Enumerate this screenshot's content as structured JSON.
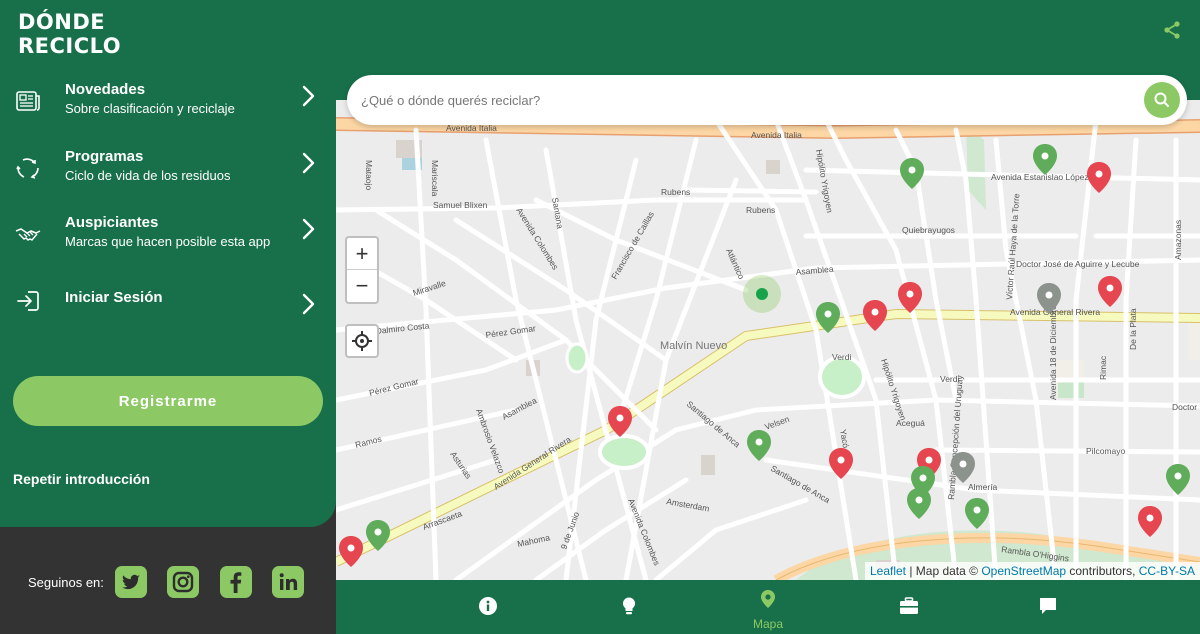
{
  "app": {
    "logo_line1": "DÓNDE",
    "logo_line2": "RECICLO"
  },
  "sidebar": {
    "items": [
      {
        "title": "Novedades",
        "subtitle": "Sobre clasificación y reciclaje",
        "icon": "newspaper-icon"
      },
      {
        "title": "Programas",
        "subtitle": "Ciclo de vida de los residuos",
        "icon": "recycle-cycle-icon"
      },
      {
        "title": "Auspiciantes",
        "subtitle": "Marcas que hacen posible esta app",
        "icon": "handshake-icon"
      },
      {
        "title": "Iniciar Sesión",
        "subtitle": "",
        "icon": "login-icon"
      }
    ],
    "register_label": "Registrarme",
    "repeat_intro_label": "Repetir introducción",
    "follow_label": "Seguinos en:",
    "social": [
      "twitter-icon",
      "instagram-icon",
      "facebook-icon",
      "linkedin-icon"
    ]
  },
  "search": {
    "placeholder": "¿Qué o dónde querés reciclar?"
  },
  "map": {
    "zoom_in": "+",
    "zoom_out": "−",
    "attribution_leaflet": "Leaflet",
    "attribution_sep": " | Map data © ",
    "attribution_osm": "OpenStreetMap",
    "attribution_mid": " contributors, ",
    "attribution_license": "CC-BY-SA",
    "neighborhood": "Malvín Nuevo",
    "streets": {
      "italia": "Avenida Italia",
      "rivera": "Avenida General Rivera",
      "rivera2": "Avenida General Rivera",
      "estanislao": "Avenida Estanislao López",
      "ohiggins": "Rambla O'Higgins",
      "rubens": "Rubens",
      "rubens2": "Rubens",
      "quiebrayugos": "Quiebrayugos",
      "aguirre": "Doctor José de Aguirre y Lecube",
      "samuel": "Samuel Blixen",
      "perez": "Pérez Gomar",
      "perez2": "Pérez Gomar",
      "dalmiro": "Dalmiro Costa",
      "asamblea": "Asamblea",
      "asamblea2": "Asamblea",
      "verdi": "Verdi",
      "verdi2": "Verdi",
      "acegua": "Aceguá",
      "pilcomayo": "Pilcomayo",
      "almeria": "Almería",
      "amsterdam": "Amsterdam",
      "mahoma": "Mahoma",
      "ramos": "Ramos",
      "arrascaeta": "Arrascaeta",
      "santiago": "Santiago de Anca",
      "hipolito": "Hipólito Yrigoyen",
      "velsen": "Velsen",
      "yaco": "Yacó",
      "colombes": "Avenida Colombes",
      "canelones": "Avenida Colombes",
      "mataojo": "Mataojo",
      "mariscala": "Mariscala",
      "santana": "Santana",
      "miravalle": "Miravalle",
      "atlantico": "Atlántico",
      "caillas": "Francisco de Caillas",
      "diciembre": "Avenida 18 de Diciembre",
      "laplata": "De la Plata",
      "rimac": "Rimac",
      "amazonas": "Amazonas",
      "raul": "Víctor Raúl Haya de la Torre",
      "concepcion": "Rambla Concepción del Uruguay",
      "junio": "9 de Junio",
      "ambrosio": "Ambrosio Velazco",
      "asturias": "Asturias",
      "doctor": "Doctor"
    }
  },
  "bottom_nav": {
    "items": [
      {
        "label": "",
        "icon": "info-icon",
        "active": false
      },
      {
        "label": "",
        "icon": "lightbulb-icon",
        "active": false
      },
      {
        "label": "Mapa",
        "icon": "map-pin-icon",
        "active": true
      },
      {
        "label": "",
        "icon": "toolbox-icon",
        "active": false
      },
      {
        "label": "",
        "icon": "chat-bubble-icon",
        "active": false
      }
    ]
  },
  "colors": {
    "brand_green": "#17704a",
    "accent_green": "#8cc965",
    "marker_red": "#e5464f",
    "marker_green": "#5fad5a",
    "marker_gray": "#8c938c",
    "dark": "#333333"
  }
}
